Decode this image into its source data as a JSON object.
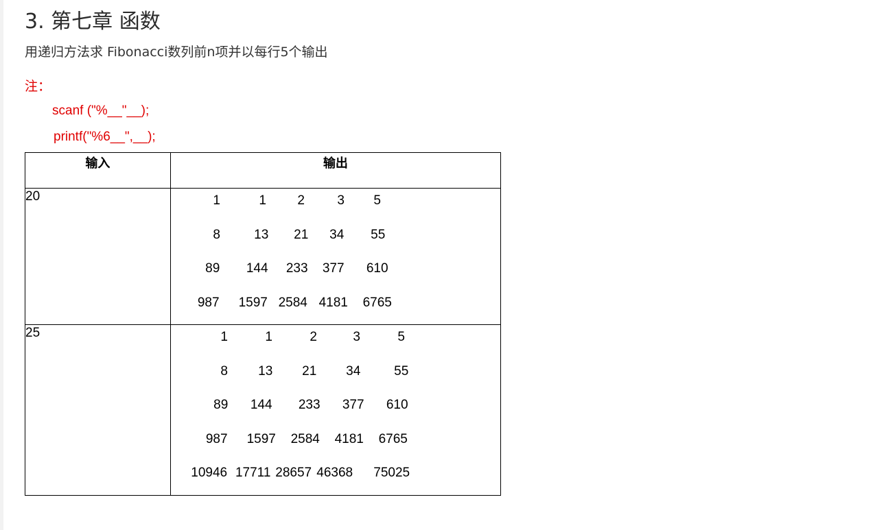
{
  "heading": "3. 第七章 函数",
  "description": "用递归方法求 Fibonacci数列前n项并以每行5个输出",
  "note": {
    "label": "注：",
    "lines": [
      "scanf (\"%__\"__);",
      "printf(\"%6__\",__);"
    ]
  },
  "table": {
    "headers": {
      "input": "输入",
      "output": "输出"
    },
    "rows": [
      {
        "input": "20",
        "output": [
          [
            "1",
            "1",
            "2",
            "3",
            "5"
          ],
          [
            "8",
            "13",
            "21",
            "34",
            "55"
          ],
          [
            "89",
            "144",
            "233",
            "377",
            "610"
          ],
          [
            "987",
            "1597",
            "2584",
            "4181",
            "6765"
          ]
        ]
      },
      {
        "input": "25",
        "output": [
          [
            "1",
            "1",
            "2",
            "3",
            "5"
          ],
          [
            "8",
            "13",
            "21",
            "34",
            "55"
          ],
          [
            "89",
            "144",
            "233",
            "377",
            "610"
          ],
          [
            "987",
            "1597",
            "2584",
            "4181",
            "6765"
          ],
          [
            "10946",
            "17711",
            "28657",
            "46368",
            "75025"
          ]
        ]
      }
    ]
  }
}
